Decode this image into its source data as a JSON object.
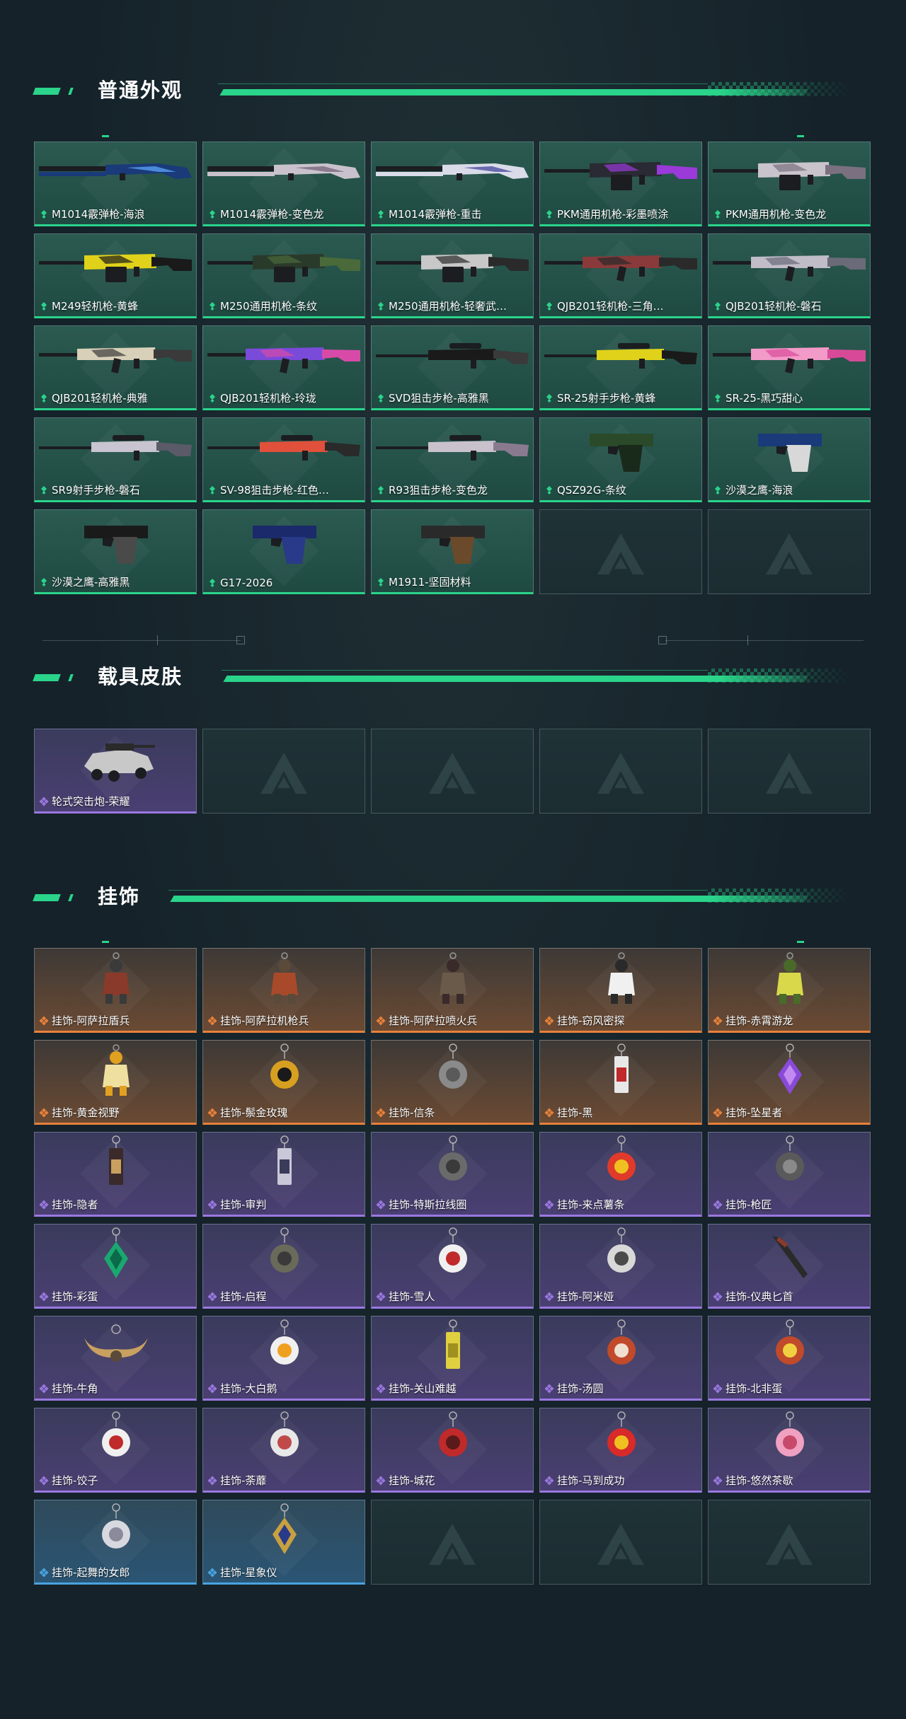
{
  "colors": {
    "accent": "#2ad48a",
    "tier_green": "#2ad48a",
    "tier_orange": "#e8813a",
    "tier_purple": "#9a78e0",
    "tier_blue": "#4aa3e0"
  },
  "sections": [
    {
      "title": "普通外观",
      "items": [
        {
          "name": "M1014霰弹枪-海浪",
          "tier": "green",
          "art": "shotgun",
          "c1": "#1a3a7a",
          "c2": "#4a8ad8"
        },
        {
          "name": "M1014霰弹枪-变色龙",
          "tier": "green",
          "art": "shotgun",
          "c1": "#c9c2cc",
          "c2": "#8a7a90"
        },
        {
          "name": "M1014霰弹枪-重击",
          "tier": "green",
          "art": "shotgun",
          "c1": "#d9dbe8",
          "c2": "#6a6ab0"
        },
        {
          "name": "PKM通用机枪-彩墨喷涂",
          "tier": "green",
          "art": "mg",
          "c1": "#2a2a34",
          "c2": "#9a3ad8"
        },
        {
          "name": "PKM通用机枪-变色龙",
          "tier": "green",
          "art": "mg",
          "c1": "#c9c4cc",
          "c2": "#7a7080"
        },
        {
          "name": "M249轻机枪-黄蜂",
          "tier": "green",
          "art": "mg",
          "c1": "#e0d21a",
          "c2": "#1a1a1a"
        },
        {
          "name": "M250通用机枪-条纹",
          "tier": "green",
          "art": "mg",
          "c1": "#2a3a2a",
          "c2": "#4a6a3a"
        },
        {
          "name": "M250通用机枪-轻奢武…",
          "tier": "green",
          "art": "mg",
          "c1": "#c8c8c8",
          "c2": "#2a2a2a"
        },
        {
          "name": "QJB201轻机枪-三角…",
          "tier": "green",
          "art": "rifle",
          "c1": "#8a3a3a",
          "c2": "#2a2a2a"
        },
        {
          "name": "QJB201轻机枪-磐石",
          "tier": "green",
          "art": "rifle",
          "c1": "#c0bcc8",
          "c2": "#6a6a78"
        },
        {
          "name": "QJB201轻机枪-典雅",
          "tier": "green",
          "art": "rifle",
          "c1": "#d8d0b8",
          "c2": "#3a3a3a"
        },
        {
          "name": "QJB201轻机枪-玲珑",
          "tier": "green",
          "art": "rifle",
          "c1": "#7a4ad8",
          "c2": "#d84aa8"
        },
        {
          "name": "SVD狙击步枪-高雅黑",
          "tier": "green",
          "art": "sniper",
          "c1": "#1a1a1a",
          "c2": "#3a3a3a"
        },
        {
          "name": "SR-25射手步枪-黄蜂",
          "tier": "green",
          "art": "sniper",
          "c1": "#e0d21a",
          "c2": "#1a1a1a"
        },
        {
          "name": "SR-25-黑巧甜心",
          "tier": "green",
          "art": "rifle",
          "c1": "#f29ac8",
          "c2": "#d84a98"
        },
        {
          "name": "SR9射手步枪-磐石",
          "tier": "green",
          "art": "sniper",
          "c1": "#c8c4d0",
          "c2": "#5a5a68"
        },
        {
          "name": "SV-98狙击步枪-红色…",
          "tier": "green",
          "art": "sniper",
          "c1": "#e0503a",
          "c2": "#2a2a2a"
        },
        {
          "name": "R93狙击步枪-变色龙",
          "tier": "green",
          "art": "sniper",
          "c1": "#c9c2cc",
          "c2": "#8a7a90"
        },
        {
          "name": "QSZ92G-条纹",
          "tier": "green",
          "art": "pistol",
          "c1": "#2a4a2a",
          "c2": "#1a2a1a"
        },
        {
          "name": "沙漠之鹰-海浪",
          "tier": "green",
          "art": "pistol",
          "c1": "#1a3a7a",
          "c2": "#d8d8d8"
        },
        {
          "name": "沙漠之鹰-高雅黑",
          "tier": "green",
          "art": "pistol",
          "c1": "#1a1a1a",
          "c2": "#4a4a4a"
        },
        {
          "name": "G17-2026",
          "tier": "green",
          "art": "pistol",
          "c1": "#1a2a6a",
          "c2": "#2a3a8a"
        },
        {
          "name": "M1911-坚固材料",
          "tier": "green",
          "art": "pistol",
          "c1": "#2a2a2a",
          "c2": "#6a4a2a"
        },
        {
          "name": "",
          "tier": "empty"
        },
        {
          "name": "",
          "tier": "empty"
        }
      ]
    },
    {
      "title": "载具皮肤",
      "items": [
        {
          "name": "轮式突击炮-荣耀",
          "tier": "purple",
          "art": "vehicle",
          "c1": "#c8c8c8",
          "c2": "#2a2a2a"
        },
        {
          "name": "",
          "tier": "empty"
        },
        {
          "name": "",
          "tier": "empty"
        },
        {
          "name": "",
          "tier": "empty"
        },
        {
          "name": "",
          "tier": "empty"
        }
      ]
    },
    {
      "title": "挂饰",
      "items": [
        {
          "name": "挂饰-阿萨拉盾兵",
          "tier": "orange",
          "art": "figure",
          "c1": "#8a3a2a",
          "c2": "#3a3a3a"
        },
        {
          "name": "挂饰-阿萨拉机枪兵",
          "tier": "orange",
          "art": "figure",
          "c1": "#a84a2a",
          "c2": "#5a4a3a"
        },
        {
          "name": "挂饰-阿萨拉喷火兵",
          "tier": "orange",
          "art": "figure",
          "c1": "#6a5a4a",
          "c2": "#3a2a2a"
        },
        {
          "name": "挂饰-窃风密探",
          "tier": "orange",
          "art": "figure",
          "c1": "#f0f0f0",
          "c2": "#2a2a2a"
        },
        {
          "name": "挂饰-赤霄游龙",
          "tier": "orange",
          "art": "figure",
          "c1": "#d8d84a",
          "c2": "#4a6a2a"
        },
        {
          "name": "挂饰-黄金视野",
          "tier": "orange",
          "art": "figure",
          "c1": "#f0e0a0",
          "c2": "#e0a020"
        },
        {
          "name": "挂饰-鬃金玫瑰",
          "tier": "orange",
          "art": "charm",
          "c1": "#d8a020",
          "c2": "#1a1a1a"
        },
        {
          "name": "挂饰-信条",
          "tier": "orange",
          "art": "charm",
          "c1": "#8a8a8a",
          "c2": "#5a5a5a"
        },
        {
          "name": "挂饰-黑",
          "tier": "orange",
          "art": "tag",
          "c1": "#e8e8e8",
          "c2": "#c02a2a"
        },
        {
          "name": "挂饰-坠星者",
          "tier": "orange",
          "art": "gem",
          "c1": "#8a4ad8",
          "c2": "#c08af0"
        },
        {
          "name": "挂饰-隐者",
          "tier": "purple",
          "art": "tag",
          "c1": "#3a2a2a",
          "c2": "#c8a060"
        },
        {
          "name": "挂饰-审判",
          "tier": "purple",
          "art": "tag",
          "c1": "#c8c8d8",
          "c2": "#3a3a5a"
        },
        {
          "name": "挂饰-特斯拉线圈",
          "tier": "purple",
          "art": "charm",
          "c1": "#6a6a6a",
          "c2": "#3a3a3a"
        },
        {
          "name": "挂饰-来点薯条",
          "tier": "purple",
          "art": "charm",
          "c1": "#e03a2a",
          "c2": "#f0c020"
        },
        {
          "name": "挂饰-枪匠",
          "tier": "purple",
          "art": "charm",
          "c1": "#5a5a5a",
          "c2": "#8a8a8a"
        },
        {
          "name": "挂饰-彩蛋",
          "tier": "purple",
          "art": "gem",
          "c1": "#1aa870",
          "c2": "#0a6a4a"
        },
        {
          "name": "挂饰-启程",
          "tier": "purple",
          "art": "charm",
          "c1": "#6a6a5a",
          "c2": "#3a3a3a"
        },
        {
          "name": "挂饰-雪人",
          "tier": "purple",
          "art": "charm",
          "c1": "#f0f0f0",
          "c2": "#c02a2a"
        },
        {
          "name": "挂饰-阿米娅",
          "tier": "purple",
          "art": "charm",
          "c1": "#d8d8d8",
          "c2": "#4a4a4a"
        },
        {
          "name": "挂饰-仪典匕首",
          "tier": "purple",
          "art": "dagger",
          "c1": "#2a2a2a",
          "c2": "#8a3a2a"
        },
        {
          "name": "挂饰-牛角",
          "tier": "purple",
          "art": "horn",
          "c1": "#c8a060",
          "c2": "#5a4a3a"
        },
        {
          "name": "挂饰-大白鹅",
          "tier": "purple",
          "art": "charm",
          "c1": "#f0f0f0",
          "c2": "#f0a020"
        },
        {
          "name": "挂饰-关山难越",
          "tier": "purple",
          "art": "tag",
          "c1": "#e0d040",
          "c2": "#a09020"
        },
        {
          "name": "挂饰-汤圆",
          "tier": "purple",
          "art": "charm",
          "c1": "#c04a2a",
          "c2": "#f0e0d0"
        },
        {
          "name": "挂饰-北非蛋",
          "tier": "purple",
          "art": "charm",
          "c1": "#c04a2a",
          "c2": "#f0d040"
        },
        {
          "name": "挂饰-饺子",
          "tier": "purple",
          "art": "charm",
          "c1": "#f0f0f0",
          "c2": "#c02a2a"
        },
        {
          "name": "挂饰-荼蘼",
          "tier": "purple",
          "art": "charm",
          "c1": "#e8e8e8",
          "c2": "#c04a4a"
        },
        {
          "name": "挂饰-城花",
          "tier": "purple",
          "art": "charm",
          "c1": "#c02a2a",
          "c2": "#5a1a1a"
        },
        {
          "name": "挂饰-马到成功",
          "tier": "purple",
          "art": "charm",
          "c1": "#d82a2a",
          "c2": "#f0c020"
        },
        {
          "name": "挂饰-悠然茶歇",
          "tier": "purple",
          "art": "charm",
          "c1": "#f0a0c0",
          "c2": "#c84a6a"
        },
        {
          "name": "挂饰-起舞的女郎",
          "tier": "blue",
          "art": "charm",
          "c1": "#d8d8e0",
          "c2": "#8a8a9a"
        },
        {
          "name": "挂饰-星象仪",
          "tier": "blue",
          "art": "gem",
          "c1": "#c8a040",
          "c2": "#2a3a8a"
        },
        {
          "name": "",
          "tier": "empty"
        },
        {
          "name": "",
          "tier": "empty"
        },
        {
          "name": "",
          "tier": "empty"
        }
      ]
    }
  ]
}
